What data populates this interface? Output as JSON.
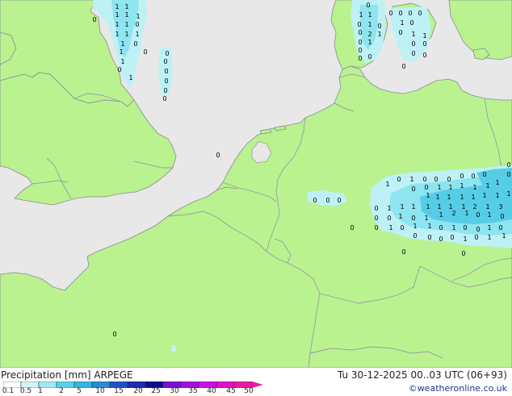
{
  "map": {
    "colors": {
      "sea": "#e8e8e8",
      "land": "#b9f28f",
      "border": "#9a9aa6",
      "coast": "#8a8a96",
      "precip_light": "#bdf1f6",
      "precip_mid": "#8ee4ef",
      "precip_heavy": "#56cde6",
      "marker": "#000000"
    },
    "marker_labels": [
      "0",
      "1",
      "2",
      "3"
    ]
  },
  "footer": {
    "title": "Precipitation [mm]  ARPEGE",
    "valid_time": "Tu 30-12-2025 00..03 UTC (06+93)",
    "credit": "©weatheronline.co.uk"
  },
  "legend": {
    "ticks": [
      "0.1",
      "0.5",
      "1",
      "2",
      "5",
      "10",
      "15",
      "20",
      "25",
      "30",
      "35",
      "40",
      "45",
      "50"
    ],
    "colors": [
      "#ffffff",
      "#d2f5fa",
      "#9ee8f2",
      "#5ad0ea",
      "#32b6e0",
      "#2a8ad8",
      "#2050c8",
      "#1a2cb0",
      "#10108c",
      "#7a10d0",
      "#a010e0",
      "#c810e6",
      "#e010c8",
      "#e81aa0"
    ]
  }
}
